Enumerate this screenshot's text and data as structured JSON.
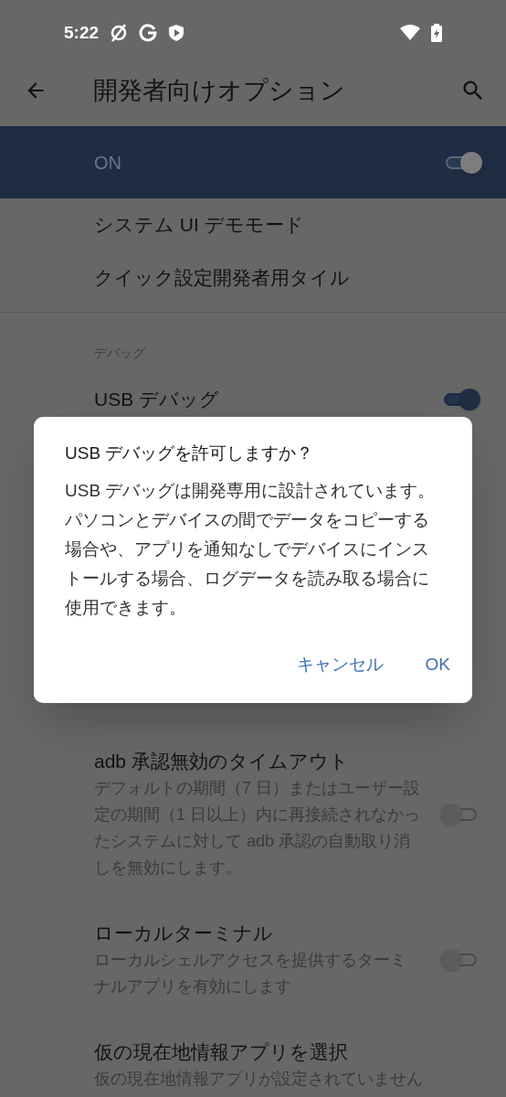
{
  "status_bar": {
    "time": "5:22"
  },
  "toolbar": {
    "title": "開発者向けオプション"
  },
  "master_switch": {
    "label": "ON",
    "on": true
  },
  "items_above": [
    {
      "kind": "plain",
      "title": "システム UI デモモード"
    },
    {
      "kind": "plain",
      "title": "クイック設定開発者用タイル"
    },
    {
      "kind": "category",
      "title": "デバッグ"
    },
    {
      "kind": "switch",
      "title": "USB デバッグ",
      "on": true
    }
  ],
  "items_below": [
    {
      "kind": "switch",
      "title": "adb 承認無効のタイムアウト",
      "summary": "デフォルトの期間（7 日）またはユーザー設定の期間（1 日以上）内に再接続されなかったシステムに対して adb 承認の自動取り消しを無効にします。",
      "on": false
    },
    {
      "kind": "switch",
      "title": "ローカルターミナル",
      "summary": "ローカルシェルアクセスを提供するターミナルアプリを有効にします",
      "on": false
    },
    {
      "kind": "plain",
      "title": "仮の現在地情報アプリを選択",
      "summary": "仮の現在地情報アプリが設定されていません"
    }
  ],
  "dialog": {
    "title": "USB デバッグを許可しますか？",
    "message": "USB デバッグは開発専用に設計されています。パソコンとデバイスの間でデータをコピーする場合や、アプリを通知なしでデバイスにインストールする場合、ログデータを読み取る場合に使用できます。",
    "buttons": [
      "キャンセル",
      "OK"
    ]
  }
}
